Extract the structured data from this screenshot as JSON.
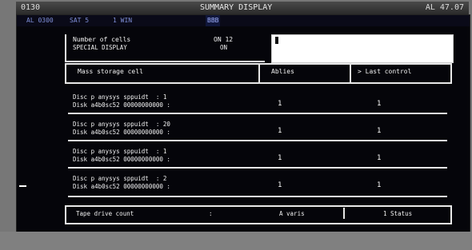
{
  "window": {
    "title_left": "0130",
    "title_center": "SUMMARY DISPLAY",
    "title_right": "AL 47.07"
  },
  "menubar": {
    "item1": "AL 0300",
    "item2": "SAT 5",
    "item3": "1 WIN",
    "item4": "BBB"
  },
  "header": {
    "line1_label": "Number of cells",
    "line1_value": "ON 12",
    "line2_label": "SPECIAL DISPLAY",
    "line2_value": "ON",
    "input_value": ""
  },
  "columns": {
    "label": "Mass storage cell",
    "col1": "Ablies",
    "col2": "> Last control"
  },
  "rows": [
    {
      "line1": "Disc p anysys sppuidt  : 1",
      "line2": "Disk a4b0sc52 00000000000 :",
      "v1": "1",
      "v2": "1"
    },
    {
      "line1": "Disc p anysys sppuidt  : 20",
      "line2": "Disk a4b0sc52 00000000000 :",
      "v1": "1",
      "v2": "1"
    },
    {
      "line1": "Disc p anysys sppuidt  : 1",
      "line2": "Disk a4b0sc52 00000000000 :",
      "v1": "1",
      "v2": "1"
    },
    {
      "line1": "Disc p anysys sppuidt  : 2",
      "line2": "Disk a4b0sc52 00000000000 :",
      "v1": "1",
      "v2": "1"
    }
  ],
  "footer": {
    "label": "Tape drive count",
    "sep": ":",
    "col1": "A varis",
    "col2": "1 Status"
  },
  "colors": {
    "screen_bg": "#05050a",
    "frame": "#777777",
    "text": "#f2f2f2",
    "menu_accent": "#7f8fd8"
  }
}
